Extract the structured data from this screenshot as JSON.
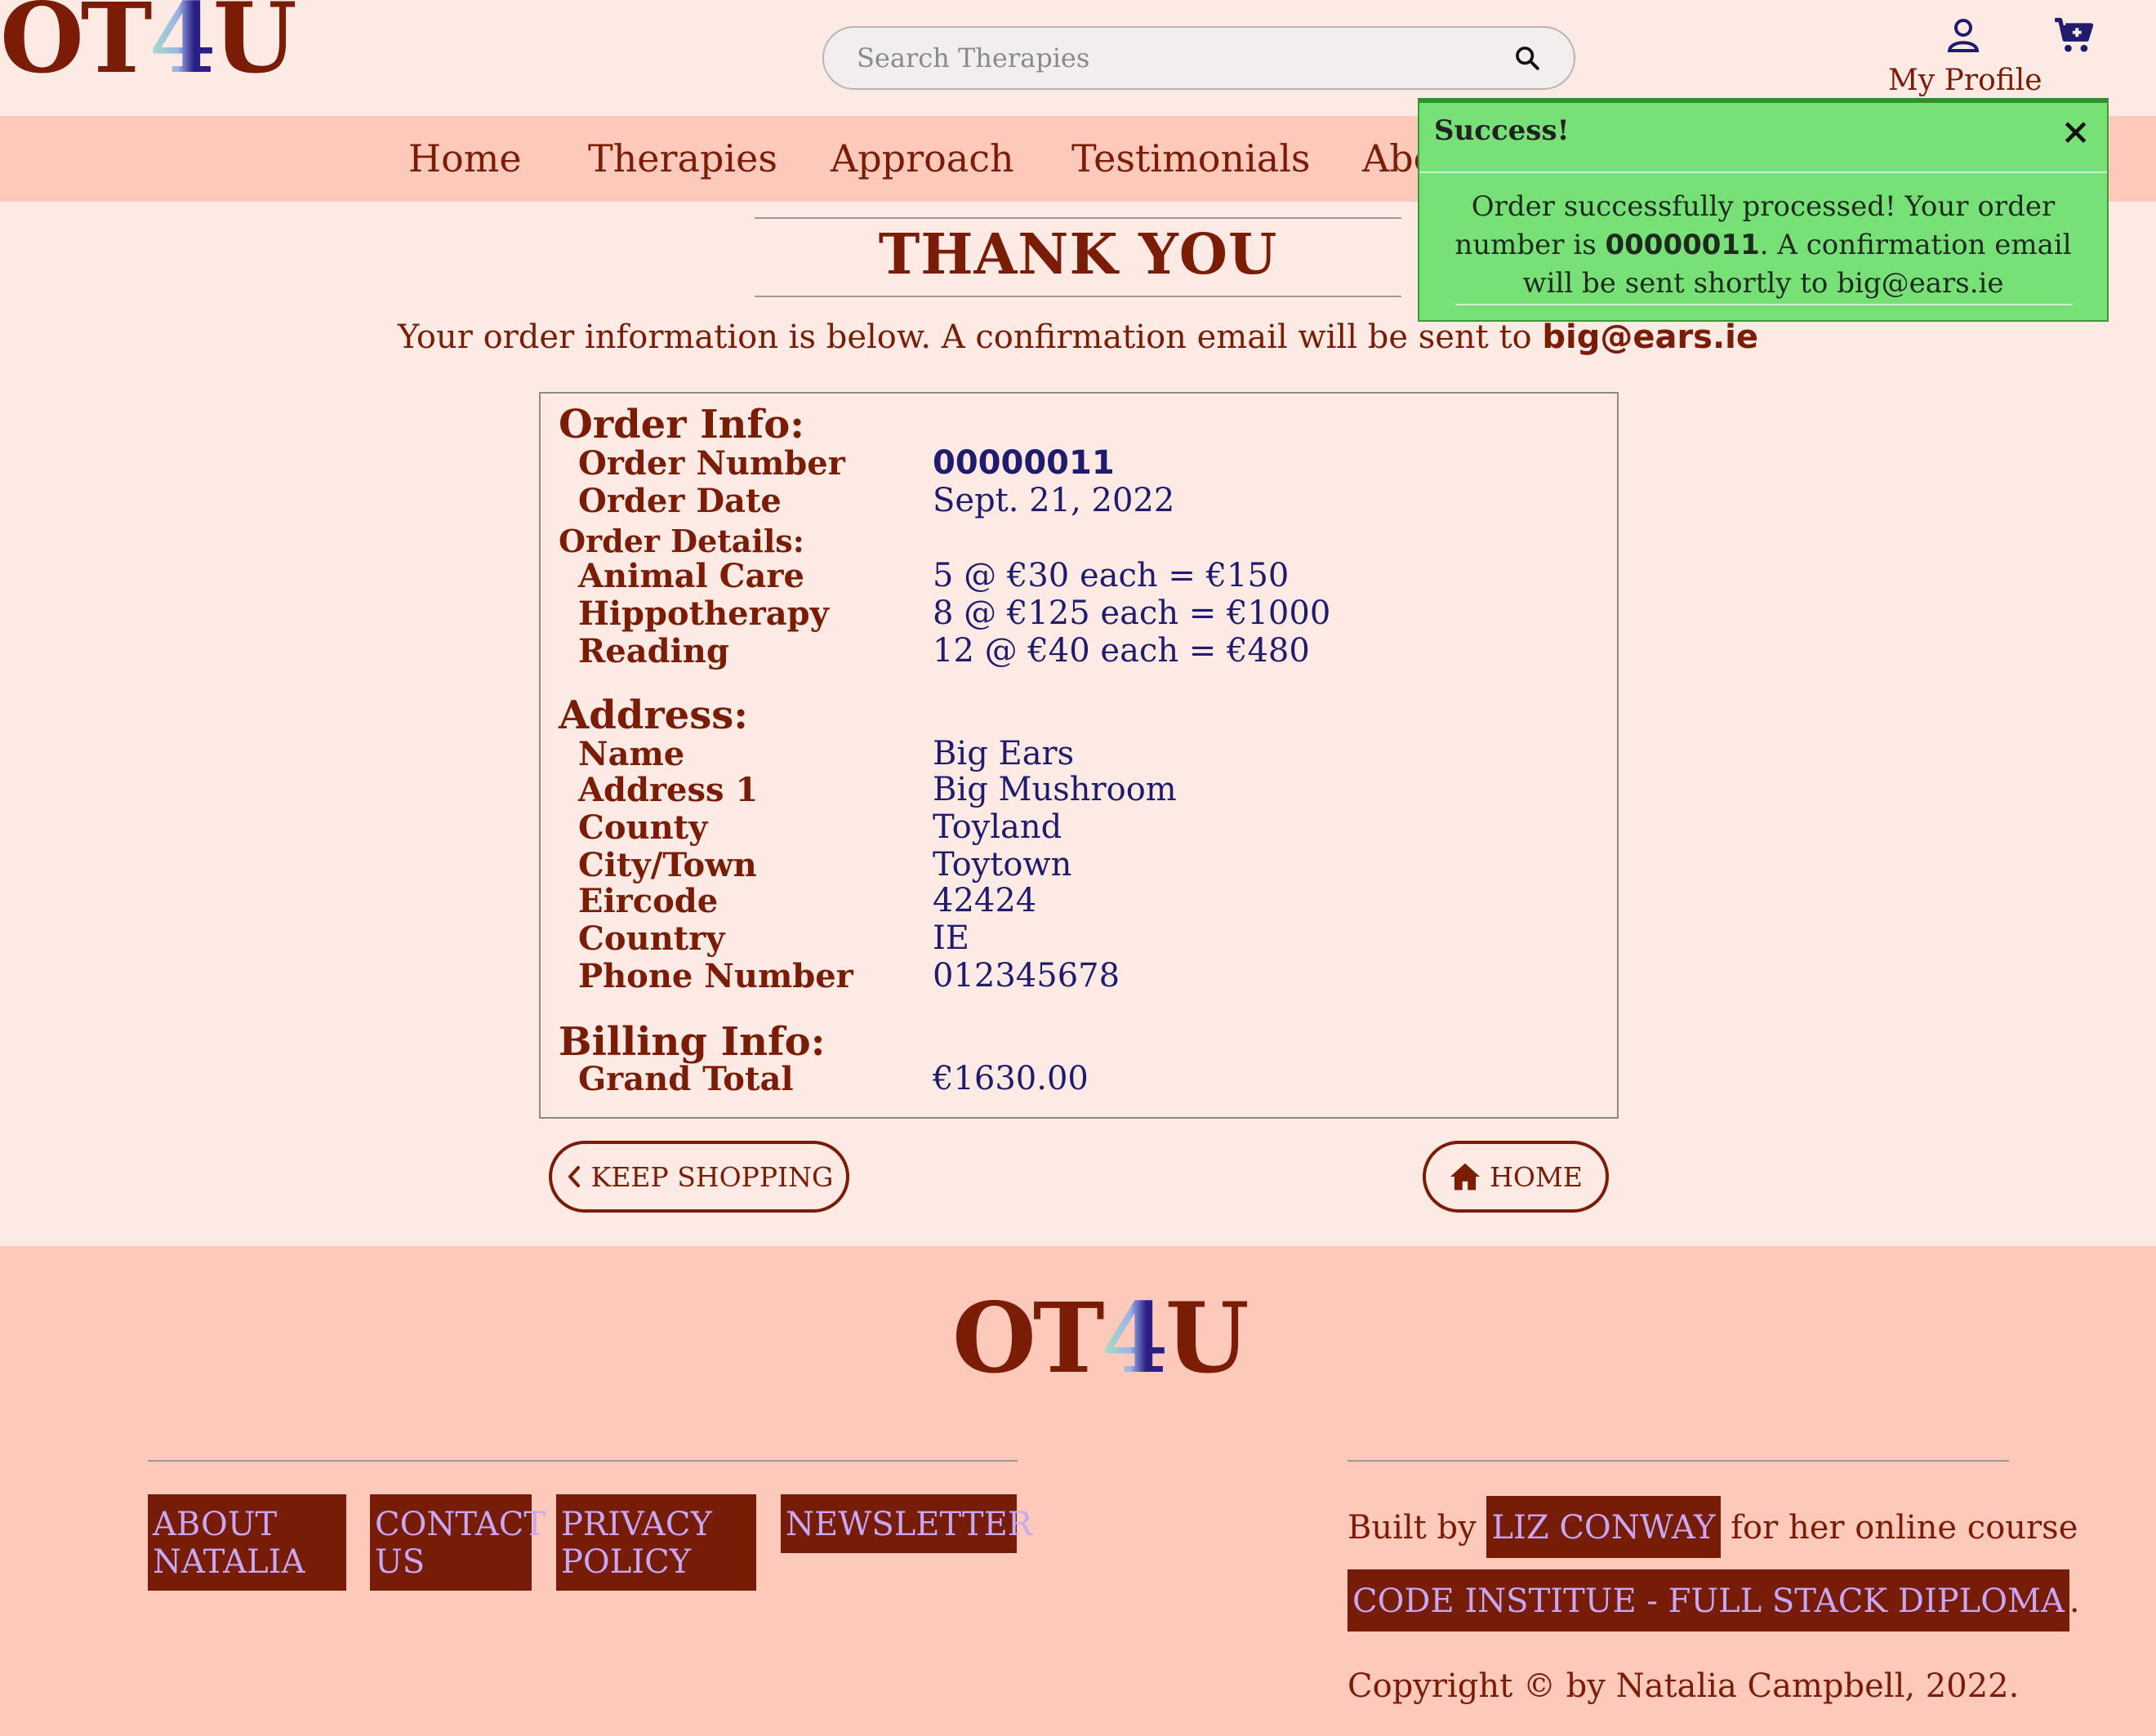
{
  "header": {
    "logo": {
      "part1": "OT",
      "part2": "4",
      "part3": "U"
    },
    "search_placeholder": "Search Therapies",
    "profile_label": "My Profile"
  },
  "nav": {
    "items": [
      "Home",
      "Therapies",
      "Approach",
      "Testimonials",
      "Abo"
    ]
  },
  "toast": {
    "title": "Success!",
    "close": "×",
    "message_before": "Order successfully processed! Your order number is ",
    "order_number": "00000011",
    "message_after": ". A confirmation email will be sent shortly to big@ears.ie"
  },
  "main": {
    "title": "THANK YOU",
    "intro_text": "Your order information is below. A confirmation email will be sent to ",
    "intro_email": "big@ears.ie",
    "order_info": {
      "heading": "Order Info:",
      "number_label": "Order Number",
      "number_value": "00000011",
      "date_label": "Order Date",
      "date_value": "Sept. 21, 2022"
    },
    "order_details": {
      "heading": "Order Details:",
      "items": [
        {
          "label": "Animal Care",
          "value": "5 @ €30 each = €150"
        },
        {
          "label": "Hippotherapy",
          "value": "8 @ €125 each = €1000"
        },
        {
          "label": "Reading",
          "value": "12 @ €40 each = €480"
        }
      ]
    },
    "address": {
      "heading": "Address:",
      "rows": [
        {
          "label": "Name",
          "value": "Big Ears"
        },
        {
          "label": "Address 1",
          "value": "Big Mushroom"
        },
        {
          "label": "County",
          "value": "Toyland"
        },
        {
          "label": "City/Town",
          "value": "Toytown"
        },
        {
          "label": "Eircode",
          "value": "42424"
        },
        {
          "label": "Country",
          "value": "IE"
        },
        {
          "label": "Phone Number",
          "value": "012345678"
        }
      ]
    },
    "billing": {
      "heading": "Billing Info:",
      "total_label": "Grand Total",
      "total_value": "€1630.00"
    },
    "keep_shopping_label": "KEEP SHOPPING",
    "home_label": "HOME"
  },
  "footer": {
    "links": [
      "ABOUT NATALIA",
      "CONTACT US",
      "PRIVACY POLICY",
      "NEWSLETTER"
    ],
    "built_by": "Built by",
    "author": "LIZ CONWAY",
    "for_course": "for her online course",
    "course": "CODE INSTITUE - FULL STACK DIPLOMA",
    "course_period": ".",
    "copyright": "Copyright © by Natalia Campbell, 2022."
  },
  "colors": {
    "page_bg": "#fdeae4",
    "nav_bg": "#fcc9ba",
    "brand_maroon": "#7a1c06",
    "value_navy": "#1f1c6e",
    "toast_green": "#77e077",
    "footer_link_text": "#c8a8f4"
  }
}
